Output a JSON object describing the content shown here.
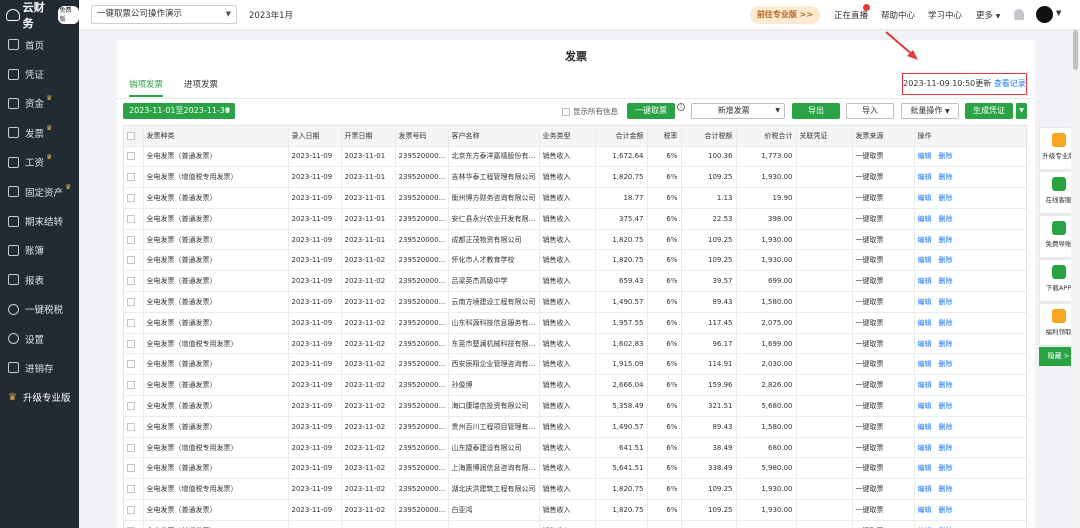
{
  "sidebar": {
    "logo_text": "云财务",
    "logo_badge": "免费版",
    "items": [
      {
        "label": "首页",
        "crown": false
      },
      {
        "label": "凭证",
        "crown": false
      },
      {
        "label": "资金",
        "crown": true
      },
      {
        "label": "发票",
        "crown": true
      },
      {
        "label": "工资",
        "crown": true
      },
      {
        "label": "固定资产",
        "crown": true
      },
      {
        "label": "期末结转",
        "crown": false
      },
      {
        "label": "账簿",
        "crown": false
      },
      {
        "label": "报表",
        "crown": false
      },
      {
        "label": "一键税税",
        "crown": false
      },
      {
        "label": "设置",
        "crown": false
      },
      {
        "label": "进销存",
        "crown": false
      }
    ],
    "upgrade_label": "升级专业版"
  },
  "header": {
    "company": "一键取票公司操作演示",
    "period": "2023年1月",
    "pro_label": "前往专业版 >>",
    "live": "正在直播",
    "help": "帮助中心",
    "learn": "学习中心",
    "more": "更多"
  },
  "page": {
    "title": "发票",
    "tabs": [
      "销项发票",
      "进项发票"
    ],
    "update_time": "2023-11-09 10:50更新",
    "view_records": "查看记录"
  },
  "toolbar": {
    "date_range": "2023-11-01至2023-11-30",
    "show_all": "显示所有信息",
    "fetch": "一键取票",
    "new_invoice": "新增发票",
    "export": "导出",
    "import": "导入",
    "batch": "批量操作",
    "gen_voucher": "生成凭证"
  },
  "table": {
    "columns": [
      "发票种类",
      "录入日期",
      "开票日期",
      "发票号码",
      "客户名称",
      "业务类型",
      "合计金额",
      "税率",
      "合计税额",
      "价税合计",
      "关联凭证",
      "发票来源",
      "操作"
    ],
    "edit": "编辑",
    "delete": "删除",
    "rows": [
      [
        "全电发票（普通发票）",
        "2023-11-09",
        "2023-11-01",
        "239520000...",
        "北京东方泰洋嘉禧股份有...",
        "销售收入",
        "1,672.64",
        "6%",
        "100.36",
        "1,773.00",
        "",
        "一键取票"
      ],
      [
        "全电发票（增值税专用发票）",
        "2023-11-09",
        "2023-11-01",
        "239520000...",
        "吉林华泰工程管理有限公司",
        "销售收入",
        "1,820.75",
        "6%",
        "109.25",
        "1,930.00",
        "",
        "一键取票"
      ],
      [
        "全电发票（普通发票）",
        "2023-11-09",
        "2023-11-01",
        "239520000...",
        "衡州博方财务咨询有限公司",
        "销售收入",
        "18.77",
        "6%",
        "1.13",
        "19.90",
        "",
        "一键取票"
      ],
      [
        "全电发票（普通发票）",
        "2023-11-09",
        "2023-11-01",
        "239520000...",
        "安仁县永兴农业开发有限...",
        "销售收入",
        "375.47",
        "6%",
        "22.53",
        "398.00",
        "",
        "一键取票"
      ],
      [
        "全电发票（普通发票）",
        "2023-11-09",
        "2023-11-01",
        "239520000...",
        "成都正茂物资有限公司",
        "销售收入",
        "1,820.75",
        "6%",
        "109.25",
        "1,930.00",
        "",
        "一键取票"
      ],
      [
        "全电发票（普通发票）",
        "2023-11-09",
        "2023-11-02",
        "239520000...",
        "怀化市人才教育学校",
        "销售收入",
        "1,820.75",
        "6%",
        "109.25",
        "1,930.00",
        "",
        "一键取票"
      ],
      [
        "全电发票（普通发票）",
        "2023-11-09",
        "2023-11-02",
        "239520000...",
        "吕梁英杰高级中学",
        "销售收入",
        "659.43",
        "6%",
        "39.57",
        "699.00",
        "",
        "一键取票"
      ],
      [
        "全电发票（普通发票）",
        "2023-11-09",
        "2023-11-02",
        "239520000...",
        "云南方境建设工程有限公司",
        "销售收入",
        "1,490.57",
        "6%",
        "89.43",
        "1,580.00",
        "",
        "一键取票"
      ],
      [
        "全电发票（普通发票）",
        "2023-11-09",
        "2023-11-02",
        "239520000...",
        "山东科源科技信息服务有...",
        "销售收入",
        "1,957.55",
        "6%",
        "117.45",
        "2,075.00",
        "",
        "一键取票"
      ],
      [
        "全电发票（增值税专用发票）",
        "2023-11-09",
        "2023-11-02",
        "239520000...",
        "东莞市楚澜机械科技有限...",
        "销售收入",
        "1,602.83",
        "6%",
        "96.17",
        "1,699.00",
        "",
        "一键取票"
      ],
      [
        "全电发票（普通发票）",
        "2023-11-09",
        "2023-11-02",
        "239520000...",
        "西安辰翔企业管理咨询有...",
        "销售收入",
        "1,915.09",
        "6%",
        "114.91",
        "2,030.00",
        "",
        "一键取票"
      ],
      [
        "全电发票（普通发票）",
        "2023-11-09",
        "2023-11-02",
        "239520000...",
        "孙俊博",
        "销售收入",
        "2,666.04",
        "6%",
        "159.96",
        "2,826.00",
        "",
        "一键取票"
      ],
      [
        "全电发票（普通发票）",
        "2023-11-09",
        "2023-11-02",
        "239520000...",
        "海口康瑞信投资有限公司",
        "销售收入",
        "5,358.49",
        "6%",
        "321.51",
        "5,680.00",
        "",
        "一键取票"
      ],
      [
        "全电发票（普通发票）",
        "2023-11-09",
        "2023-11-02",
        "239520000...",
        "贵州百川工程项目管理有...",
        "销售收入",
        "1,490.57",
        "6%",
        "89.43",
        "1,580.00",
        "",
        "一键取票"
      ],
      [
        "全电发票（增值税专用发票）",
        "2023-11-09",
        "2023-11-02",
        "239520000...",
        "山东捷泰建设有限公司",
        "销售收入",
        "641.51",
        "6%",
        "38.49",
        "680.00",
        "",
        "一键取票"
      ],
      [
        "全电发票（普通发票）",
        "2023-11-09",
        "2023-11-02",
        "239520000...",
        "上海惠博润信息咨询有限...",
        "销售收入",
        "5,641.51",
        "6%",
        "338.49",
        "5,980.00",
        "",
        "一键取票"
      ],
      [
        "全电发票（增值税专用发票）",
        "2023-11-09",
        "2023-11-02",
        "239520000...",
        "湖北庆洪建筑工程有限公司",
        "销售收入",
        "1,820.75",
        "6%",
        "109.25",
        "1,930.00",
        "",
        "一键取票"
      ],
      [
        "全电发票（普通发票）",
        "2023-11-09",
        "2023-11-02",
        "239520000...",
        "白亚鸿",
        "销售收入",
        "1,820.75",
        "6%",
        "109.25",
        "1,930.00",
        "",
        "一键取票"
      ],
      [
        "全电发票（普通发票）",
        "2023-11-09",
        "2023-11-02",
        "239520000...",
        "",
        "销售收入",
        "",
        "6%",
        "",
        "",
        "",
        "一键取票"
      ]
    ]
  },
  "float_panel": {
    "items": [
      "升级专业版",
      "在线客服",
      "免费导账",
      "下载APP",
      "福利领取"
    ],
    "hide": "隐藏 >"
  },
  "colors": {
    "accent": "#2aa344",
    "link": "#1677ff",
    "sidebar_bg": "#222a33",
    "highlight": "#e53935"
  }
}
